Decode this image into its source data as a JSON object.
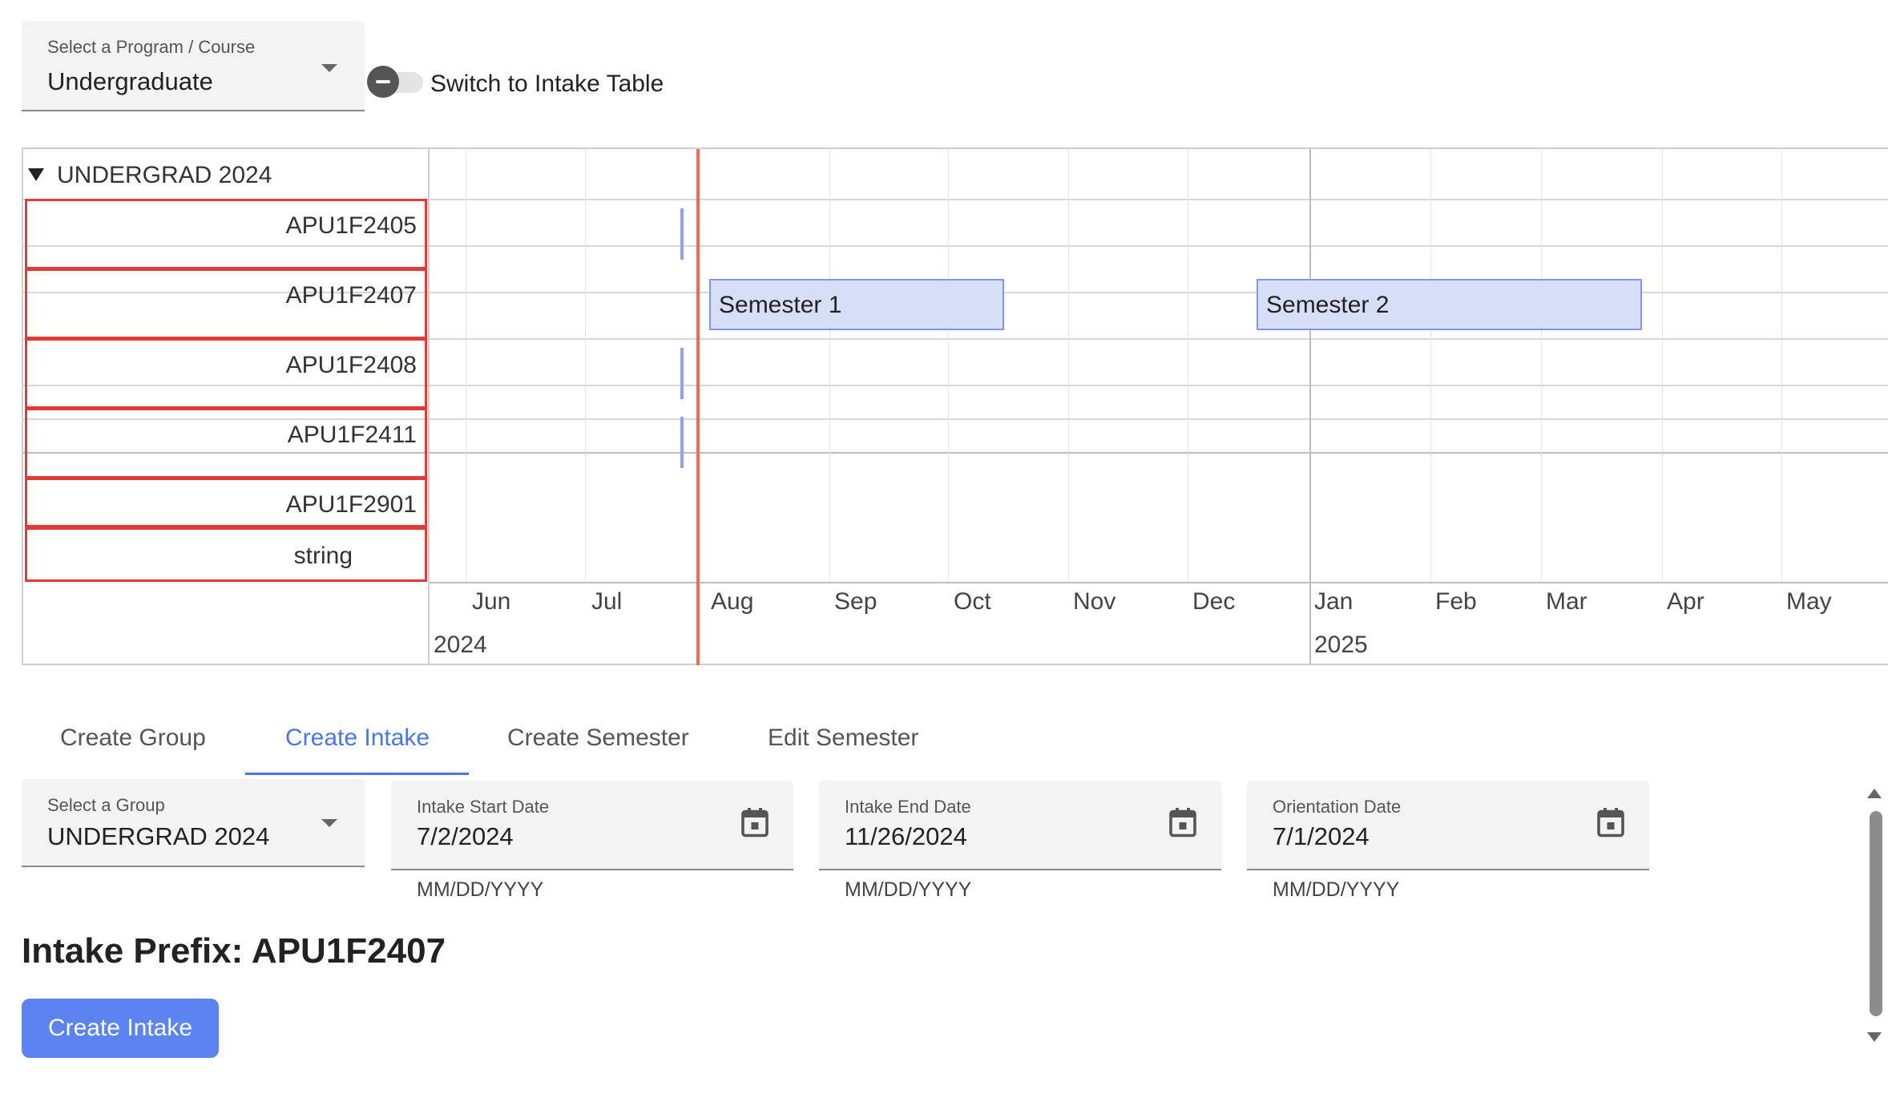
{
  "program_select": {
    "label": "Select a Program / Course",
    "value": "Undergraduate"
  },
  "toggle": {
    "label": "Switch to Intake Table"
  },
  "gantt": {
    "group": "UNDERGRAD 2024",
    "intakes": [
      "APU1F2405",
      "APU1F2407",
      "APU1F2408",
      "APU1F2411",
      "APU1F2901",
      "string"
    ],
    "semesters": [
      {
        "label": "Semester 1",
        "row": 1,
        "start": "2024-08",
        "end": "2024-10"
      },
      {
        "label": "Semester 2",
        "row": 1,
        "start": "2024-12",
        "end": "2025-03"
      }
    ],
    "months": [
      "Jun",
      "Jul",
      "Aug",
      "Sep",
      "Oct",
      "Nov",
      "Dec",
      "Jan",
      "Feb",
      "Mar",
      "Apr",
      "May"
    ],
    "years": [
      "2024",
      "2025"
    ]
  },
  "tabs": [
    {
      "label": "Create Group",
      "active": false
    },
    {
      "label": "Create Intake",
      "active": true
    },
    {
      "label": "Create Semester",
      "active": false
    },
    {
      "label": "Edit Semester",
      "active": false
    }
  ],
  "form": {
    "group_select": {
      "label": "Select a Group",
      "value": "UNDERGRAD 2024"
    },
    "intake_start": {
      "label": "Intake Start Date",
      "value": "7/2/2024",
      "helper": "MM/DD/YYYY"
    },
    "intake_end": {
      "label": "Intake End Date",
      "value": "11/26/2024",
      "helper": "MM/DD/YYYY"
    },
    "orientation": {
      "label": "Orientation Date",
      "value": "7/1/2024",
      "helper": "MM/DD/YYYY"
    },
    "prefix_text": "Intake Prefix: APU1F2407",
    "submit_label": "Create Intake"
  },
  "colors": {
    "accent": "#4a76e8",
    "button": "#5b84f1",
    "today_line": "#ef6c52",
    "bar_fill": "#d7def8",
    "row_border": "#e23a3a"
  }
}
